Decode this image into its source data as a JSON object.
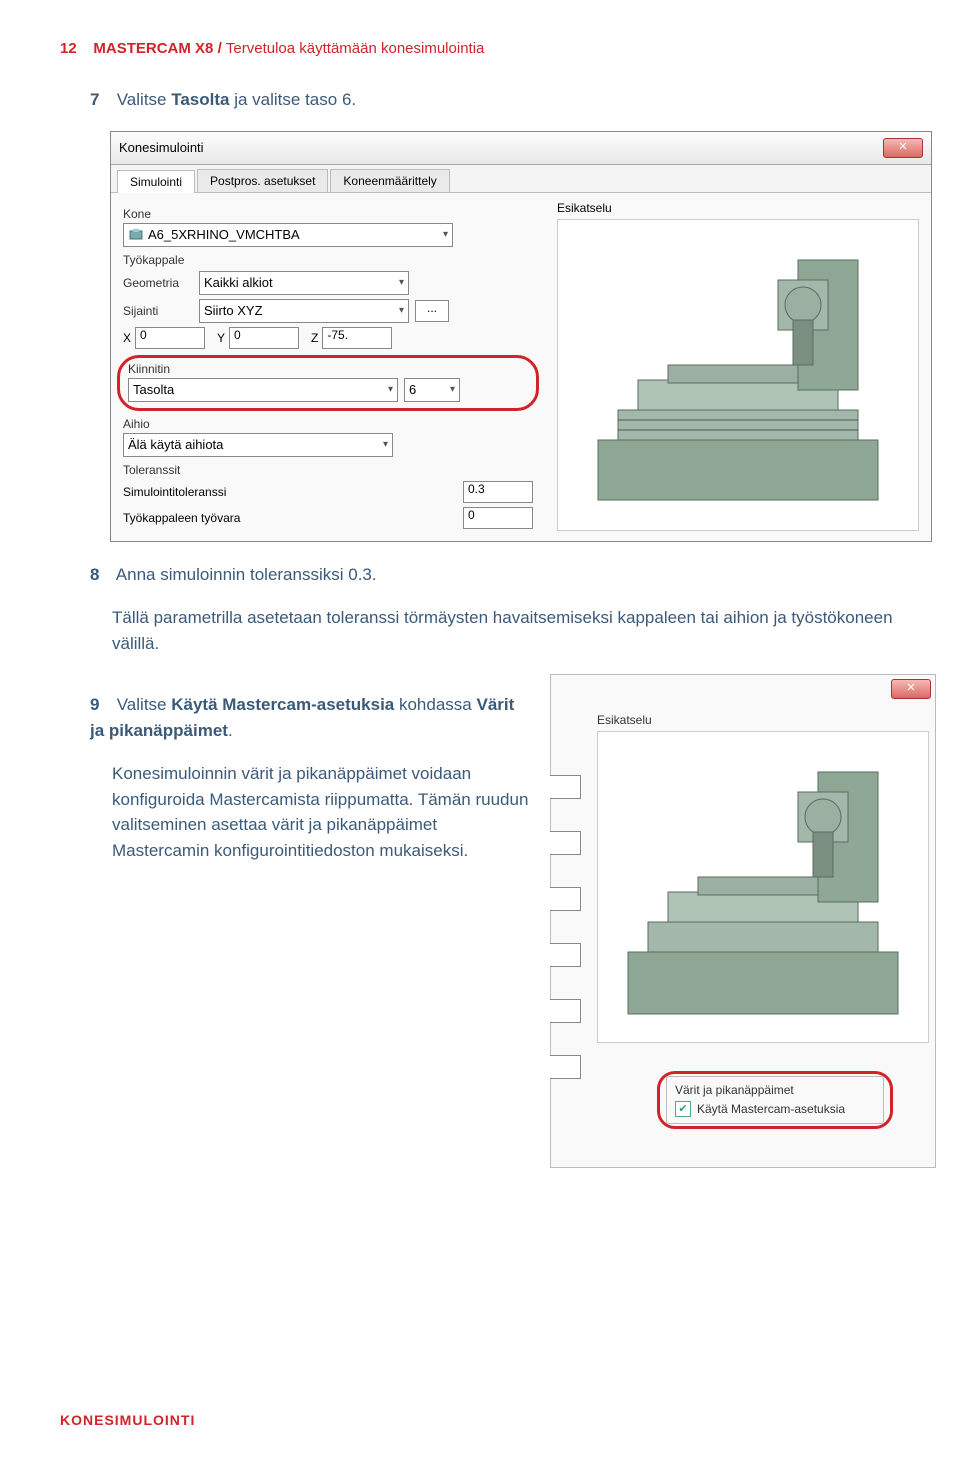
{
  "header": {
    "page_num": "12",
    "product": "MASTERCAM X8",
    "slash": "/",
    "subtitle": "Tervetuloa käyttämään konesimulointia"
  },
  "steps": {
    "s7_num": "7",
    "s7_text_a": "Valitse ",
    "s7_bold": "Tasolta",
    "s7_text_b": " ja valitse taso 6.",
    "s8_num": "8",
    "s8_text": "Anna simuloinnin toleranssiksi 0.3.",
    "s8_sub": "Tällä parametrilla asetetaan toleranssi törmäysten havaitsemiseksi kappaleen tai aihion ja työstökoneen välillä.",
    "s9_num": "9",
    "s9_text_a": "Valitse ",
    "s9_bold1": "Käytä Mastercam-asetuksia",
    "s9_text_b": " kohdassa ",
    "s9_bold2": "Värit ja pikanäppäimet",
    "s9_text_c": ".",
    "s9_sub": "Konesimuloinnin värit ja pikanäppäimet voidaan konfiguroida Mastercamista riippumatta. Tämän ruudun valitseminen asettaa värit ja pikanäppäimet Mastercamin konfigurointitiedoston mukaiseksi."
  },
  "dialog": {
    "title": "Konesimulointi",
    "tabs": [
      "Simulointi",
      "Postpros. asetukset",
      "Koneenmäärittely"
    ],
    "kone_label": "Kone",
    "kone_value": "A6_5XRHINO_VMCHTBA",
    "tyokappale_label": "Työkappale",
    "geometria_label": "Geometria",
    "geometria_value": "Kaikki alkiot",
    "sijainti_label": "Sijainti",
    "sijainti_value": "Siirto XYZ",
    "ellipsis": "...",
    "x_label": "X",
    "x_value": "0",
    "y_label": "Y",
    "y_value": "0",
    "z_label": "Z",
    "z_value": "-75.",
    "kiinnitin_label": "Kiinnitin",
    "kiinnitin_value": "Tasolta",
    "kiinnitin_num": "6",
    "aihio_label": "Aihio",
    "aihio_value": "Älä käytä aihiota",
    "toleranssit_label": "Toleranssit",
    "simtol_label": "Simulointitoleranssi",
    "simtol_value": "0.3",
    "tyovara_label": "Työkappaleen työvara",
    "tyovara_value": "0",
    "esikatselu_label": "Esikatselu"
  },
  "snippet2": {
    "esikatselu_label": "Esikatselu",
    "colors_title": "Värit ja pikanäppäimet",
    "colors_checkbox": "Käytä Mastercam-asetuksia"
  },
  "footer": "KONESIMULOINTI"
}
